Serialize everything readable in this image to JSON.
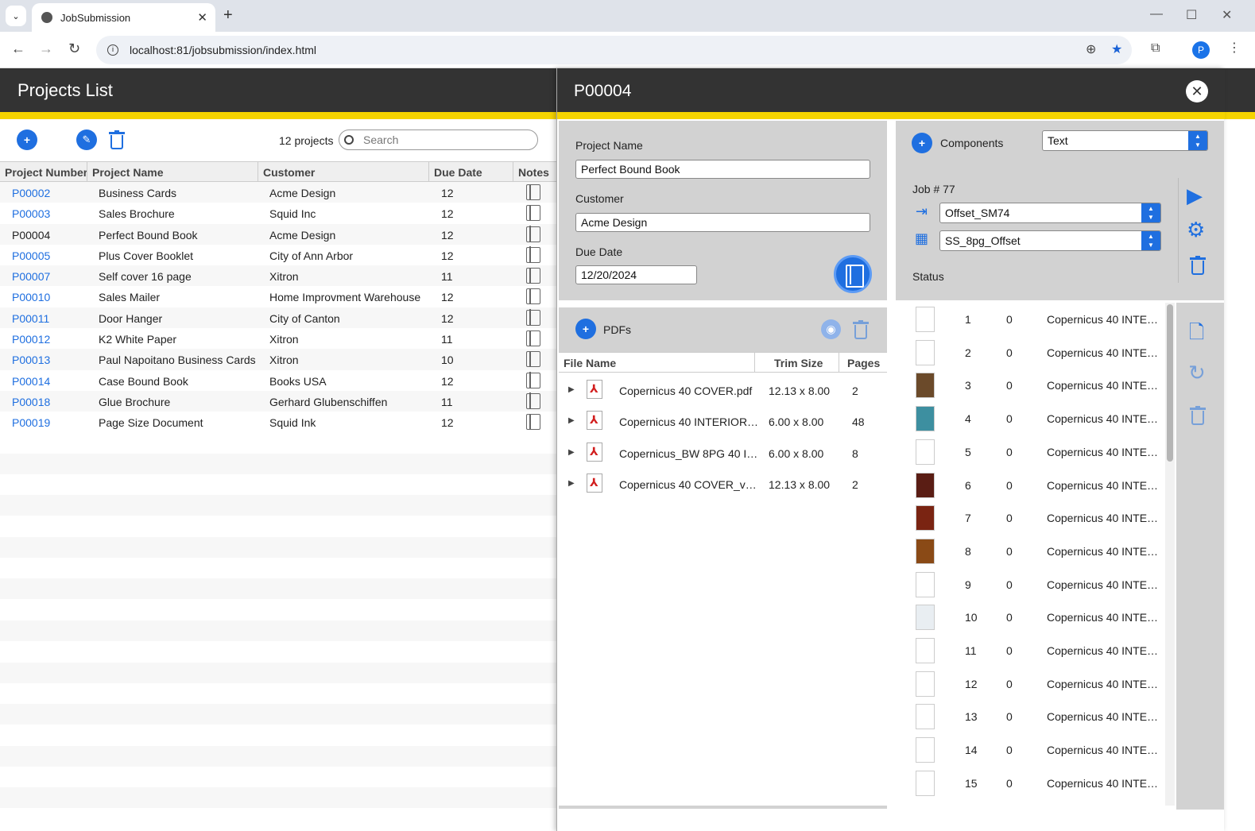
{
  "browser": {
    "tab_title": "JobSubmission",
    "url": "localhost:81/jobsubmission/index.html",
    "profile_initial": "P"
  },
  "app": {
    "title": "Projects List",
    "project_count": "12 projects",
    "search_placeholder": "Search",
    "columns": [
      "Project Number",
      "Project Name",
      "Customer",
      "Due Date",
      "Notes"
    ],
    "projects": [
      {
        "number": "P00002",
        "name": "Business Cards",
        "customer": "Acme Design",
        "due": "12",
        "link": true
      },
      {
        "number": "P00003",
        "name": "Sales Brochure",
        "customer": "Squid Inc",
        "due": "12",
        "link": true
      },
      {
        "number": "P00004",
        "name": "Perfect Bound Book",
        "customer": "Acme Design",
        "due": "12",
        "link": false
      },
      {
        "number": "P00005",
        "name": "Plus Cover Booklet",
        "customer": "City of Ann Arbor",
        "due": "12",
        "link": true
      },
      {
        "number": "P00007",
        "name": "Self cover 16 page",
        "customer": "Xitron",
        "due": "11",
        "link": true
      },
      {
        "number": "P00010",
        "name": "Sales Mailer",
        "customer": "Home Improvment Warehouse",
        "due": "12",
        "link": true
      },
      {
        "number": "P00011",
        "name": "Door Hanger",
        "customer": "City of Canton",
        "due": "12",
        "link": true
      },
      {
        "number": "P00012",
        "name": "K2 White Paper",
        "customer": "Xitron",
        "due": "11",
        "link": true
      },
      {
        "number": "P00013",
        "name": "Paul Napoitano Business Cards",
        "customer": "Xitron",
        "due": "10",
        "link": true
      },
      {
        "number": "P00014",
        "name": "Case Bound Book",
        "customer": "Books USA",
        "due": "12",
        "link": true
      },
      {
        "number": "P00018",
        "name": "Glue Brochure",
        "customer": "Gerhard Glubenschiffen",
        "due": "11",
        "link": true
      },
      {
        "number": "P00019",
        "name": "Page Size Document",
        "customer": "Squid Ink",
        "due": "12",
        "link": true
      }
    ]
  },
  "detail": {
    "title": "P00004",
    "project_name_label": "Project Name",
    "project_name": "Perfect Bound Book",
    "customer_label": "Customer",
    "customer": "Acme Design",
    "due_date_label": "Due Date",
    "due_date": "12/20/2024",
    "components_label": "Components",
    "components_select": "Text",
    "job_label": "Job # 77",
    "press_select": "Offset_SM74",
    "layout_select": "SS_8pg_Offset",
    "status_label": "Status",
    "pdfs_label": "PDFs",
    "pdf_columns": [
      "File Name",
      "Trim Size",
      "Pages"
    ],
    "pdfs": [
      {
        "file": "Copernicus 40 COVER.pdf",
        "trim": "12.13 x 8.00",
        "pages": "2"
      },
      {
        "file": "Copernicus 40 INTERIOR…",
        "trim": "6.00 x 8.00",
        "pages": "48"
      },
      {
        "file": "Copernicus_BW 8PG 40 I…",
        "trim": "6.00 x 8.00",
        "pages": "8"
      },
      {
        "file": "Copernicus 40 COVER_v…",
        "trim": "12.13 x 8.00",
        "pages": "2"
      }
    ],
    "components": [
      {
        "n": "1",
        "s": "0",
        "name": "Copernicus 40 INTE…"
      },
      {
        "n": "2",
        "s": "0",
        "name": "Copernicus 40 INTE…"
      },
      {
        "n": "3",
        "s": "0",
        "name": "Copernicus 40 INTE…"
      },
      {
        "n": "4",
        "s": "0",
        "name": "Copernicus 40 INTE…"
      },
      {
        "n": "5",
        "s": "0",
        "name": "Copernicus 40 INTE…"
      },
      {
        "n": "6",
        "s": "0",
        "name": "Copernicus 40 INTE…"
      },
      {
        "n": "7",
        "s": "0",
        "name": "Copernicus 40 INTE…"
      },
      {
        "n": "8",
        "s": "0",
        "name": "Copernicus 40 INTE…"
      },
      {
        "n": "9",
        "s": "0",
        "name": "Copernicus 40 INTE…"
      },
      {
        "n": "10",
        "s": "0",
        "name": "Copernicus 40 INTE…"
      },
      {
        "n": "11",
        "s": "0",
        "name": "Copernicus 40 INTE…"
      },
      {
        "n": "12",
        "s": "0",
        "name": "Copernicus 40 INTE…"
      },
      {
        "n": "13",
        "s": "0",
        "name": "Copernicus 40 INTE…"
      },
      {
        "n": "14",
        "s": "0",
        "name": "Copernicus 40 INTE…"
      },
      {
        "n": "15",
        "s": "0",
        "name": "Copernicus 40 INTE…"
      }
    ]
  },
  "colors": {
    "accent": "#1f6fe0",
    "header": "#333333",
    "stripe": "#f5d400",
    "panel_gray": "#d2d2d2"
  }
}
